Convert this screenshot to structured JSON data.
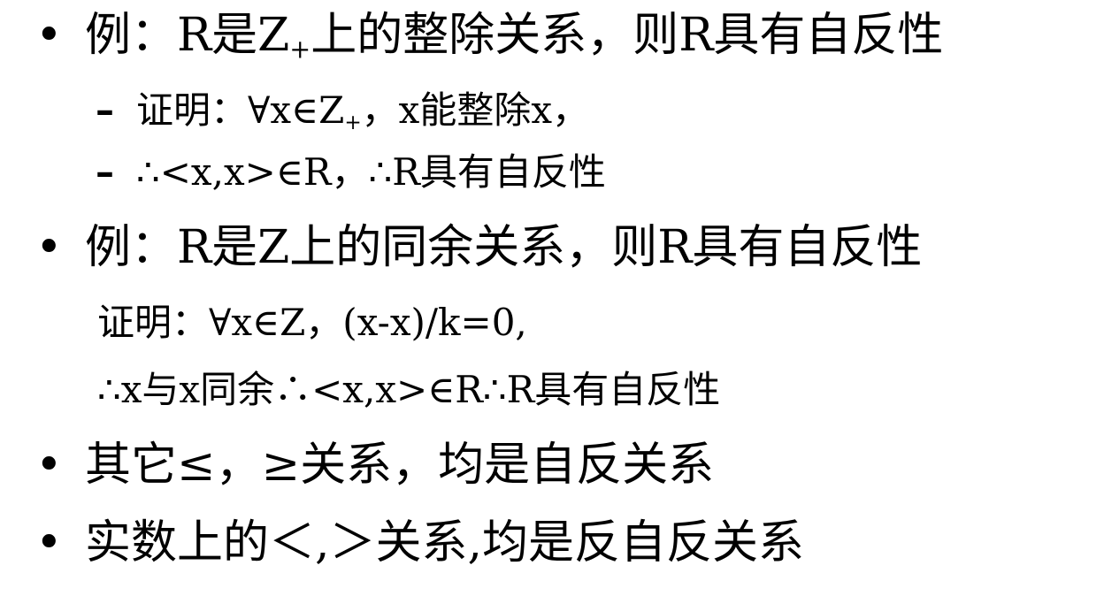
{
  "slide": {
    "items": [
      {
        "bullet": "•",
        "lead": "例：R是Z",
        "sub": "+",
        "rest": "上的整除关系，则R具有自反性"
      },
      {
        "dash": "–",
        "lead": "证明：∀x∈Z",
        "sub": "+",
        "rest": "，x能整除x，"
      },
      {
        "dash": "–",
        "text": "∴<x,x>∈R，∴R具有自反性"
      },
      {
        "bullet": "•",
        "text": "例：R是Z上的同余关系，则R具有自反性"
      },
      {
        "text": "证明：∀x∈Z，(x-x)/k=0,"
      },
      {
        "text": "∴x与x同余∴<x,x>∈R∴R具有自反性"
      },
      {
        "bullet": "•",
        "text": "其它≤，≥关系，均是自反关系"
      },
      {
        "bullet": "•",
        "text": "实数上的＜,＞关系,均是反自反关系"
      }
    ]
  }
}
